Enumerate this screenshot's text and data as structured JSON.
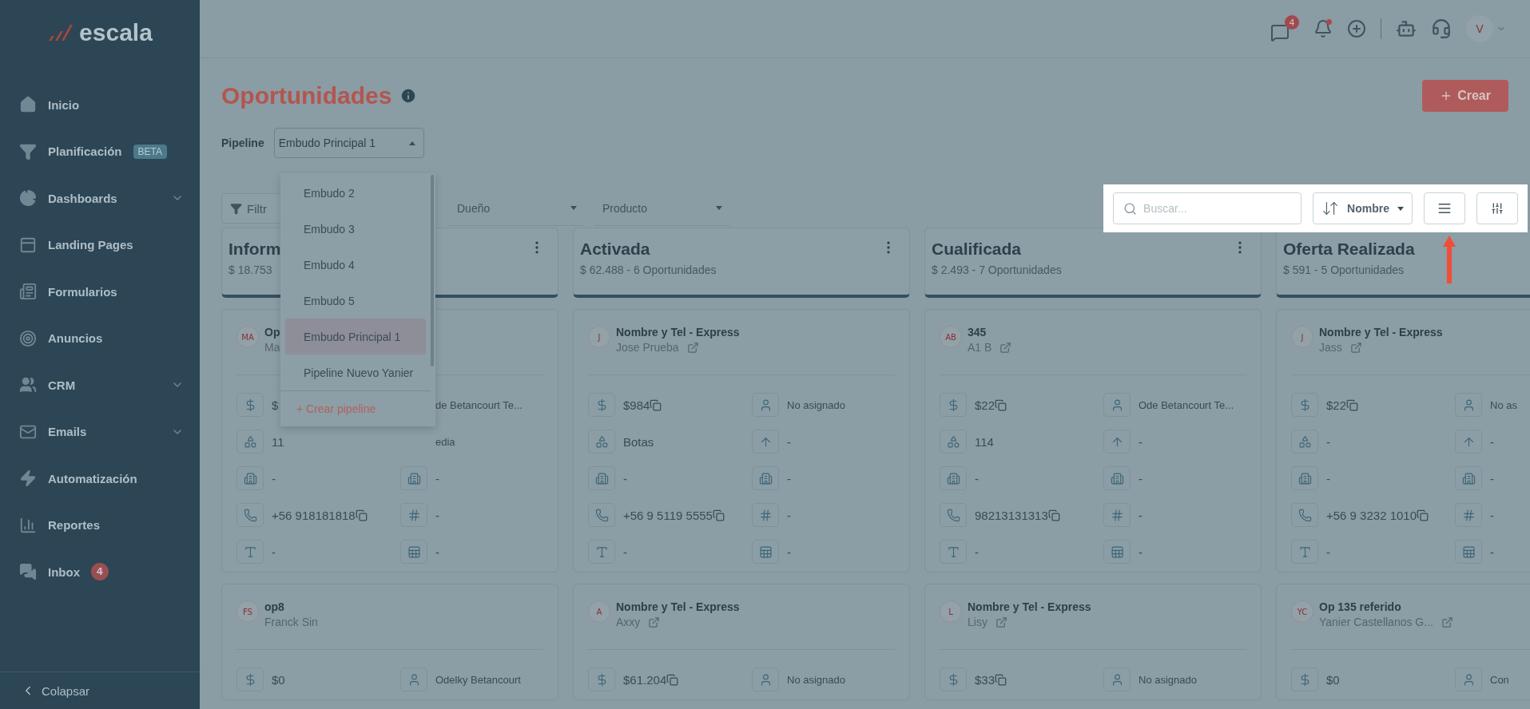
{
  "brand": {
    "name": "escala"
  },
  "sidebar": {
    "items": [
      {
        "label": "Inicio",
        "kind": "home",
        "selected": false,
        "expandable": false
      },
      {
        "label": "Planificación",
        "kind": "funnel",
        "selected": false,
        "expandable": false,
        "badge": "BETA"
      },
      {
        "label": "Dashboards",
        "kind": "pie",
        "selected": false,
        "expandable": true
      },
      {
        "label": "Landing Pages",
        "kind": "page",
        "selected": false,
        "expandable": false
      },
      {
        "label": "Formularios",
        "kind": "form",
        "selected": false,
        "expandable": false
      },
      {
        "label": "Anuncios",
        "kind": "target",
        "selected": false,
        "expandable": false
      },
      {
        "label": "CRM",
        "kind": "users",
        "selected": false,
        "expandable": true
      },
      {
        "label": "Emails",
        "kind": "mail",
        "selected": false,
        "expandable": true
      },
      {
        "label": "Automatización",
        "kind": "bolt",
        "selected": false,
        "expandable": false
      },
      {
        "label": "Reportes",
        "kind": "chart",
        "selected": false,
        "expandable": false
      },
      {
        "label": "Inbox",
        "kind": "inbox",
        "selected": false,
        "expandable": false,
        "count": "4"
      }
    ],
    "collapse": "Colapsar"
  },
  "topbar": {
    "chat_count": "4",
    "bell_unread": true,
    "avatar": "V"
  },
  "page": {
    "title": "Oportunidades",
    "create_button": "Crear"
  },
  "pipeline": {
    "label": "Pipeline",
    "value": "Embudo Principal 1",
    "expanded": true,
    "options": [
      {
        "label": "Embudo 2",
        "selected": false
      },
      {
        "label": "Embudo 3",
        "selected": false
      },
      {
        "label": "Embudo 4",
        "selected": false
      },
      {
        "label": "Embudo 5",
        "selected": false
      },
      {
        "label": "Embudo Principal 1",
        "selected": true
      },
      {
        "label": "Pipeline Nuevo Yanier",
        "selected": false
      }
    ],
    "create": "+ Crear pipeline"
  },
  "filters": {
    "filter_button": "Filtr",
    "owner": "Dueño",
    "product": "Producto"
  },
  "toolbar": {
    "highlighted": true,
    "search_placeholder": "Buscar...",
    "sort": "Nombre"
  },
  "columns": [
    {
      "title": "Inform",
      "summary": "$ 18.753",
      "cards": [
        {
          "initials": "MA",
          "title": "Op",
          "contact": "Ma",
          "link": false,
          "fields": [
            {
              "kind": "amount",
              "value": "$"
            },
            {
              "kind": "blank",
              "value": "de Betancourt Te..."
            },
            {
              "kind": "product",
              "value": "11"
            },
            {
              "kind": "blank",
              "value": "edia"
            },
            {
              "kind": "company",
              "value": "-"
            },
            {
              "kind": "company",
              "value": "-"
            },
            {
              "kind": "phone",
              "value": "+56 918181818",
              "copy": true
            },
            {
              "kind": "number",
              "value": "-"
            },
            {
              "kind": "text",
              "value": "-"
            },
            {
              "kind": "table",
              "value": "-"
            }
          ]
        },
        {
          "initials": "FS",
          "title": "op8",
          "contact": "Franck Sin",
          "link": false,
          "fields": [
            {
              "kind": "amount",
              "value": "$0"
            },
            {
              "kind": "owner",
              "value": "Odelky Betancourt"
            }
          ]
        }
      ]
    },
    {
      "title": "Activada",
      "summary": "$ 62.488 - 6 Oportunidades",
      "cards": [
        {
          "initials": "J",
          "title": "Nombre y Tel - Express",
          "contact": "Jose Prueba",
          "link": true,
          "fields": [
            {
              "kind": "amount",
              "value": "$984",
              "copy": true
            },
            {
              "kind": "owner",
              "value": "No asignado"
            },
            {
              "kind": "product",
              "value": "Botas"
            },
            {
              "kind": "priority",
              "value": "-"
            },
            {
              "kind": "company",
              "value": "-"
            },
            {
              "kind": "company",
              "value": "-"
            },
            {
              "kind": "phone",
              "value": "+56 9 5119 5555",
              "copy": true
            },
            {
              "kind": "number",
              "value": "-"
            },
            {
              "kind": "text",
              "value": "-"
            },
            {
              "kind": "table",
              "value": "-"
            }
          ]
        },
        {
          "initials": "A",
          "title": "Nombre y Tel - Express",
          "contact": "Axxy",
          "link": true,
          "fields": [
            {
              "kind": "amount",
              "value": "$61.204",
              "copy": true
            },
            {
              "kind": "owner",
              "value": "No asignado"
            }
          ]
        }
      ]
    },
    {
      "title": "Cualificada",
      "summary": "$ 2.493 - 7 Oportunidades",
      "cards": [
        {
          "initials": "AB",
          "title": "345",
          "contact": "A1 B",
          "link": true,
          "fields": [
            {
              "kind": "amount",
              "value": "$22",
              "copy": true
            },
            {
              "kind": "owner",
              "value": "Ode Betancourt Te..."
            },
            {
              "kind": "product",
              "value": "114"
            },
            {
              "kind": "priority",
              "value": "-"
            },
            {
              "kind": "company",
              "value": "-"
            },
            {
              "kind": "company",
              "value": "-"
            },
            {
              "kind": "phone",
              "value": "98213131313",
              "copy": true
            },
            {
              "kind": "number",
              "value": "-"
            },
            {
              "kind": "text",
              "value": "-"
            },
            {
              "kind": "table",
              "value": "-"
            }
          ]
        },
        {
          "initials": "L",
          "title": "Nombre y Tel - Express",
          "contact": "Lisy",
          "link": true,
          "fields": [
            {
              "kind": "amount",
              "value": "$33",
              "copy": true
            },
            {
              "kind": "owner",
              "value": "No asignado"
            }
          ]
        }
      ]
    },
    {
      "title": "Oferta Realizada",
      "summary": "$ 591 - 5 Oportunidades",
      "cards": [
        {
          "initials": "J",
          "title": "Nombre y Tel - Express",
          "contact": "Jass",
          "link": true,
          "fields": [
            {
              "kind": "amount",
              "value": "$22",
              "copy": true
            },
            {
              "kind": "owner",
              "value": "No as"
            },
            {
              "kind": "product",
              "value": "-"
            },
            {
              "kind": "priority",
              "value": "-"
            },
            {
              "kind": "company",
              "value": "-"
            },
            {
              "kind": "company",
              "value": "-"
            },
            {
              "kind": "phone",
              "value": "+56 9 3232 1010",
              "copy": true
            },
            {
              "kind": "number",
              "value": "-"
            },
            {
              "kind": "text",
              "value": "-"
            },
            {
              "kind": "table",
              "value": "-"
            }
          ]
        },
        {
          "initials": "YC",
          "title": "Op 135 referido",
          "contact": "Yanier Castellanos G...",
          "link": true,
          "fields": [
            {
              "kind": "amount",
              "value": "$0"
            },
            {
              "kind": "owner",
              "value": "Con"
            }
          ]
        }
      ]
    }
  ]
}
